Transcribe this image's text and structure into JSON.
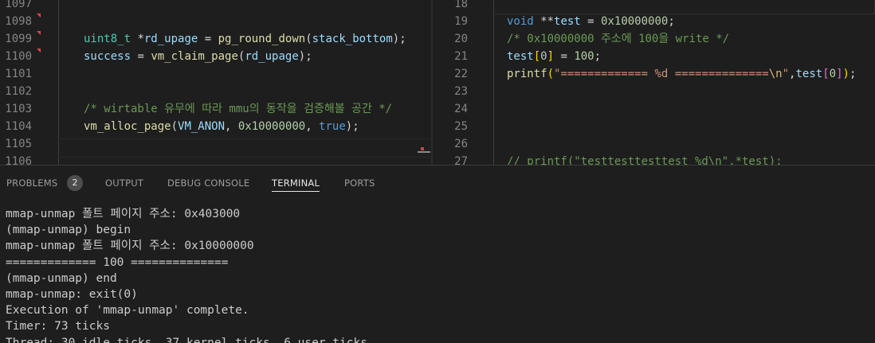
{
  "editor_left": {
    "lines": [
      {
        "num": "1097",
        "marker": true,
        "tokens": []
      },
      {
        "num": "1098",
        "marker": true,
        "tokens": []
      },
      {
        "num": "1099",
        "marker": true,
        "tokens": [
          {
            "t": "uint8_t",
            "c": "ty"
          },
          {
            "t": " *",
            "c": ""
          },
          {
            "t": "rd_upage",
            "c": "vr"
          },
          {
            "t": " = ",
            "c": ""
          },
          {
            "t": "pg_round_down",
            "c": "fn"
          },
          {
            "t": "(",
            "c": ""
          },
          {
            "t": "stack_bottom",
            "c": "vr"
          },
          {
            "t": ");",
            "c": ""
          }
        ]
      },
      {
        "num": "1100",
        "marker": true,
        "tokens": [
          {
            "t": "success",
            "c": "vr"
          },
          {
            "t": " = ",
            "c": ""
          },
          {
            "t": "vm_claim_page",
            "c": "fn"
          },
          {
            "t": "(",
            "c": ""
          },
          {
            "t": "rd_upage",
            "c": "vr"
          },
          {
            "t": ");",
            "c": ""
          }
        ]
      },
      {
        "num": "1101",
        "marker": false,
        "tokens": []
      },
      {
        "num": "1102",
        "marker": false,
        "tokens": []
      },
      {
        "num": "1103",
        "marker": false,
        "tokens": [
          {
            "t": "/* wirtable 유무에 따라 mmu의 동작을 검증해볼 공간 */",
            "c": "cm"
          }
        ]
      },
      {
        "num": "1104",
        "marker": false,
        "tokens": [
          {
            "t": "vm_alloc_page",
            "c": "fn"
          },
          {
            "t": "(",
            "c": ""
          },
          {
            "t": "VM_ANON",
            "c": "vr"
          },
          {
            "t": ", ",
            "c": ""
          },
          {
            "t": "0x10000000",
            "c": "nm"
          },
          {
            "t": ", ",
            "c": ""
          },
          {
            "t": "true",
            "c": "kw"
          },
          {
            "t": ");",
            "c": ""
          }
        ]
      },
      {
        "num": "1105",
        "marker": false,
        "tokens": []
      },
      {
        "num": "1106",
        "marker": false,
        "tokens": []
      }
    ]
  },
  "editor_right": {
    "lines": [
      {
        "num": "18",
        "tokens": []
      },
      {
        "num": "19",
        "tokens": [
          {
            "t": "void",
            "c": "kw"
          },
          {
            "t": " **",
            "c": ""
          },
          {
            "t": "test",
            "c": "vr"
          },
          {
            "t": " = ",
            "c": ""
          },
          {
            "t": "0x10000000",
            "c": "nm"
          },
          {
            "t": ";",
            "c": ""
          }
        ]
      },
      {
        "num": "20",
        "tokens": [
          {
            "t": "/* 0x10000000 주소에 100을 write */",
            "c": "cm"
          }
        ]
      },
      {
        "num": "21",
        "tokens": [
          {
            "t": "test",
            "c": "vr"
          },
          {
            "t": "[",
            "c": "pt"
          },
          {
            "t": "0",
            "c": "nm"
          },
          {
            "t": "]",
            "c": "pt"
          },
          {
            "t": " = ",
            "c": ""
          },
          {
            "t": "100",
            "c": "nm"
          },
          {
            "t": ";",
            "c": ""
          }
        ]
      },
      {
        "num": "22",
        "tokens": [
          {
            "t": "printf",
            "c": "fn"
          },
          {
            "t": "(",
            "c": "pt"
          },
          {
            "t": "\"============= %d ==============",
            "c": "st"
          },
          {
            "t": "\\n",
            "c": "es"
          },
          {
            "t": "\"",
            "c": "st"
          },
          {
            "t": ",",
            "c": ""
          },
          {
            "t": "test",
            "c": "vr"
          },
          {
            "t": "[",
            "c": "pp"
          },
          {
            "t": "0",
            "c": "nm"
          },
          {
            "t": "]",
            "c": "pp"
          },
          {
            "t": ")",
            "c": "pt"
          },
          {
            "t": ";",
            "c": ""
          }
        ]
      },
      {
        "num": "23",
        "tokens": []
      },
      {
        "num": "24",
        "tokens": []
      },
      {
        "num": "25",
        "tokens": []
      },
      {
        "num": "26",
        "tokens": []
      },
      {
        "num": "27",
        "tokens": [
          {
            "t": "// printf(\"testtesttesttest %d\\n\",*test);",
            "c": "cm"
          }
        ]
      }
    ]
  },
  "panel": {
    "tabs": {
      "problems": "PROBLEMS",
      "problems_count": "2",
      "output": "OUTPUT",
      "debug_console": "DEBUG CONSOLE",
      "terminal": "TERMINAL",
      "ports": "PORTS"
    },
    "active_tab": "TERMINAL"
  },
  "terminal": {
    "lines": [
      "mmap-unmap 폴트 페이지 주소: 0x403000",
      "(mmap-unmap) begin",
      "mmap-unmap 폴트 페이지 주소: 0x10000000",
      "============= 100 ==============",
      "(mmap-unmap) end",
      "mmap-unmap: exit(0)",
      "Execution of 'mmap-unmap' complete.",
      "Timer: 73 ticks",
      "Thread: 30 idle ticks, 37 kernel ticks, 6 user ticks"
    ]
  },
  "colors": {
    "editor_bg": "#1e1e1e",
    "line_number": "#858585",
    "keyword": "#569cd6",
    "type": "#4ec9b0",
    "function": "#dcdcaa",
    "variable": "#9cdcfe",
    "number": "#b5cea8",
    "string": "#ce9178",
    "comment": "#6a9955",
    "diff_marker": "#e04646"
  }
}
